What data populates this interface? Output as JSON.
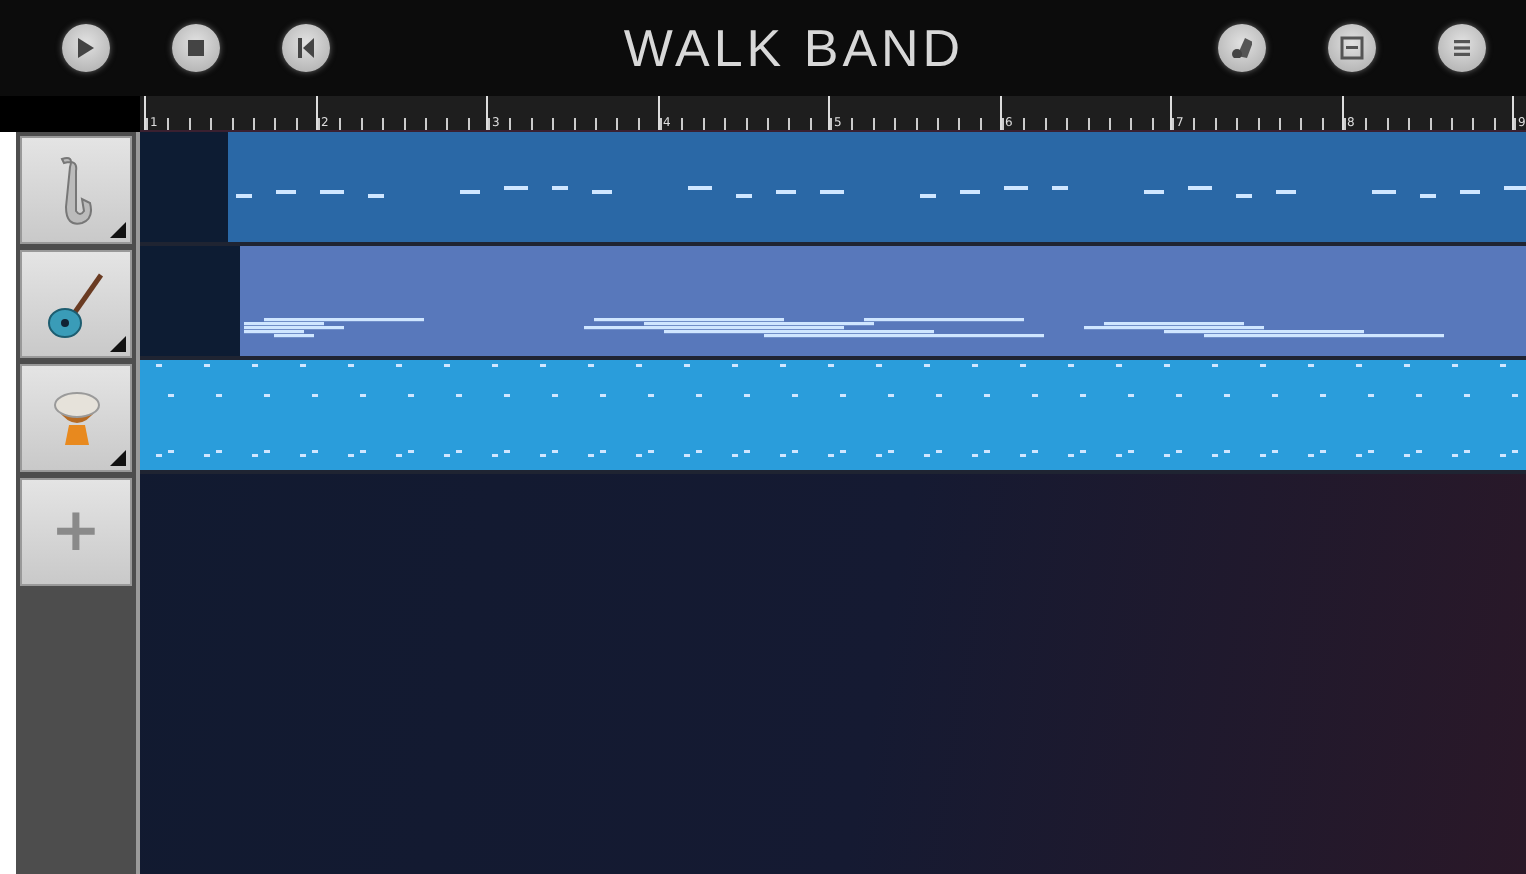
{
  "app_bar": {
    "title": "WALK BAND",
    "left_buttons": [
      {
        "kind": "play"
      },
      {
        "kind": "stop"
      },
      {
        "kind": "rewind"
      }
    ],
    "right_buttons": [
      {
        "kind": "instruments"
      },
      {
        "kind": "mixer"
      },
      {
        "kind": "menu"
      }
    ]
  },
  "ruler": {
    "bars": [
      "1",
      "2",
      "3",
      "4",
      "5",
      "6",
      "7",
      "8",
      "9"
    ]
  },
  "tracks": [
    {
      "kind": "saxophone",
      "color": "#2a68a6"
    },
    {
      "kind": "guitar",
      "color": "#5878bb"
    },
    {
      "kind": "drum",
      "color": "#2a9ddb"
    }
  ],
  "add_track": {
    "label": "+"
  }
}
